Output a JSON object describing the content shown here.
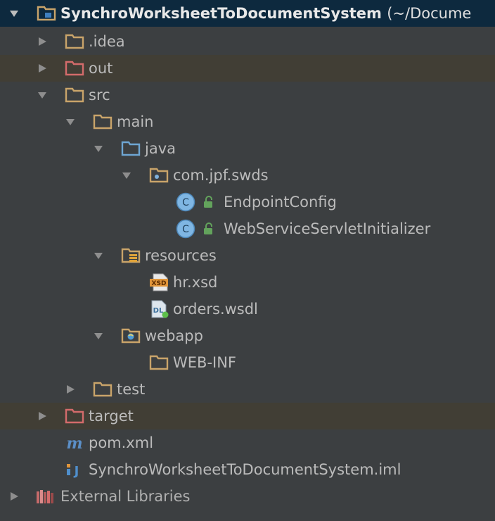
{
  "tree": {
    "root": {
      "name": "SynchroWorksheetToDocumentSystem",
      "path": "(~/Docume"
    },
    "items": [
      {
        "label": ".idea"
      },
      {
        "label": "out"
      },
      {
        "label": "src"
      },
      {
        "label": "main"
      },
      {
        "label": "java"
      },
      {
        "label": "com.jpf.swds"
      },
      {
        "label": "EndpointConfig"
      },
      {
        "label": "WebServiceServletInitializer"
      },
      {
        "label": "resources"
      },
      {
        "label": "hr.xsd"
      },
      {
        "label": "orders.wsdl"
      },
      {
        "label": "webapp"
      },
      {
        "label": "WEB-INF"
      },
      {
        "label": "test"
      },
      {
        "label": "target"
      },
      {
        "label": "pom.xml"
      },
      {
        "label": "SynchroWorksheetToDocumentSystem.iml"
      },
      {
        "label": "External Libraries"
      }
    ],
    "icon_badges": {
      "class": "C",
      "xsd": "XSD",
      "wsdl": "DL",
      "maven": "m",
      "iml": "J"
    }
  },
  "colors": {
    "background": "#3c3f41",
    "selected_row": "#0d293e",
    "excluded_row": "#413e35",
    "text": "#bbbbbb",
    "folder": "#c9a46a",
    "excluded_folder": "#d36b6b",
    "source_folder": "#6ea6d3",
    "class_icon": "#3f88c5",
    "lock": "#63a35c"
  }
}
